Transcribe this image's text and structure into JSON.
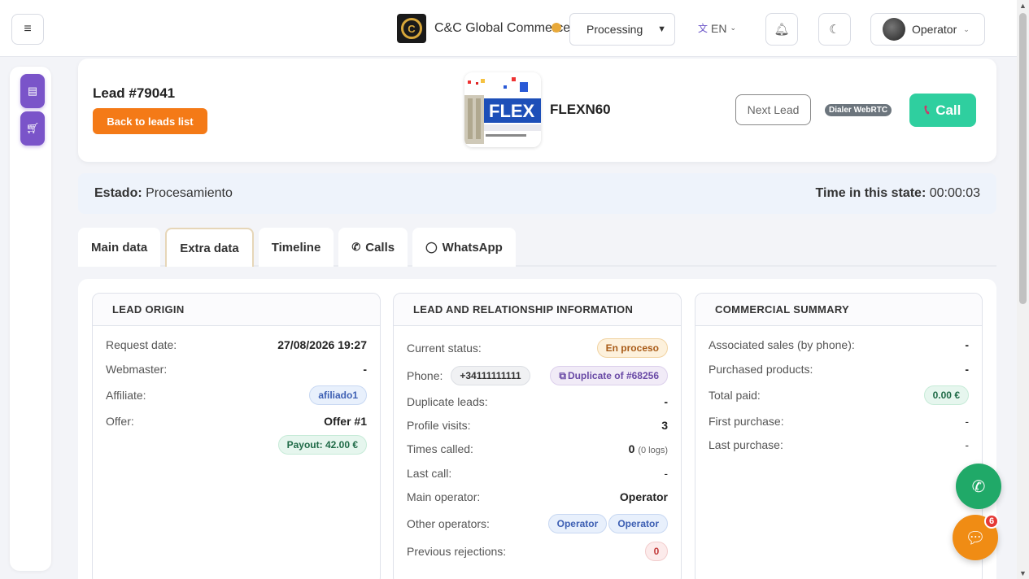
{
  "topbar": {
    "brand_name": "C&C Global Commerce FZ LLC",
    "status_value": "Processing",
    "lang": "EN",
    "user_name": "Operator"
  },
  "lead": {
    "title": "Lead #79041",
    "back_label": "Back to leads list",
    "product_name": "FLEXN60",
    "product_logo_text": "FLEX",
    "next_label": "Next Lead",
    "dialer_label": "Dialer WebRTC",
    "call_label": "Call"
  },
  "state": {
    "estado_label": "Estado:",
    "estado_value": "Procesamiento",
    "time_label": "Time in this state:",
    "time_value": "00:00:03"
  },
  "tabs": [
    {
      "label": "Main data"
    },
    {
      "label": "Extra data"
    },
    {
      "label": "Timeline"
    },
    {
      "label": "Calls"
    },
    {
      "label": "WhatsApp"
    }
  ],
  "origin": {
    "title": "LEAD ORIGIN",
    "request_date_label": "Request date:",
    "request_date_value": "27/08/2026 19:27",
    "webmaster_label": "Webmaster:",
    "webmaster_value": "-",
    "affiliate_label": "Affiliate:",
    "affiliate_value": "afiliado1",
    "offer_label": "Offer:",
    "offer_value": "Offer #1",
    "payout": "Payout: 42.00 €"
  },
  "relation": {
    "title": "LEAD AND RELATIONSHIP INFORMATION",
    "current_status_label": "Current status:",
    "current_status_value": "En proceso",
    "phone_label": "Phone:",
    "phone_value": "+34111111111",
    "duplicate_value": "Duplicate of #68256",
    "duplicate_leads_label": "Duplicate leads:",
    "duplicate_leads_value": "-",
    "profile_visits_label": "Profile visits:",
    "profile_visits_value": "3",
    "times_called_label": "Times called:",
    "times_called_value": "0",
    "times_called_logs": "(0 logs)",
    "last_call_label": "Last call:",
    "last_call_value": "-",
    "main_operator_label": "Main operator:",
    "main_operator_value": "Operator",
    "other_operators_label": "Other operators:",
    "other_operators": [
      "Operator",
      "Operator"
    ],
    "previous_rejections_label": "Previous rejections:",
    "previous_rejections_value": "0"
  },
  "commercial": {
    "title": "COMMERCIAL SUMMARY",
    "associated_sales_label": "Associated sales (by phone):",
    "associated_sales_value": "-",
    "purchased_products_label": "Purchased products:",
    "purchased_products_value": "-",
    "total_paid_label": "Total paid:",
    "total_paid_value": "0.00 €",
    "first_purchase_label": "First purchase:",
    "first_purchase_value": "-",
    "last_purchase_label": "Last purchase:",
    "last_purchase_value": "-"
  },
  "chat_badge": "6",
  "colors": {
    "accent_purple": "#7a54c9",
    "orange": "#f47a17",
    "call_green": "#2fcf9f",
    "fab_green": "#20a968",
    "fab_orange": "#f08c14"
  }
}
